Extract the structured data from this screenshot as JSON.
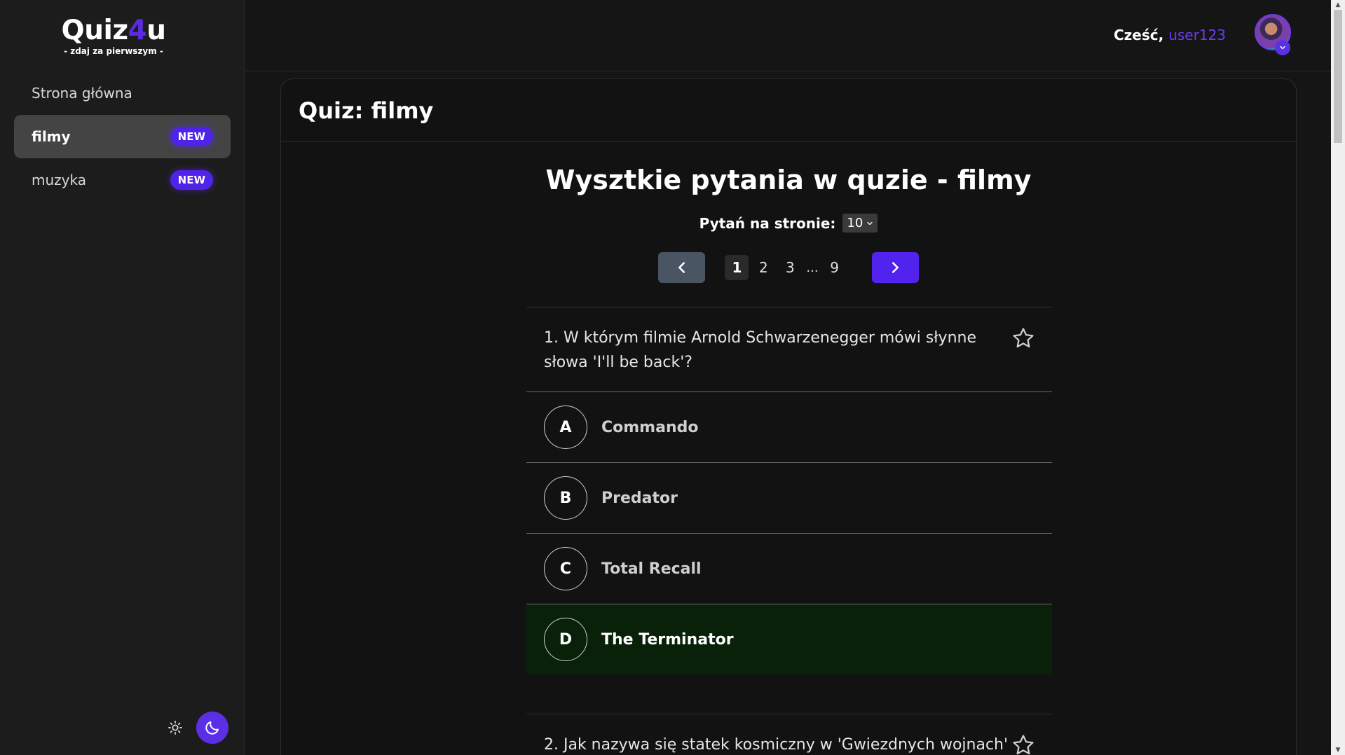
{
  "logo": {
    "title_main": "Quiz",
    "title_accent": "4",
    "title_end": "u",
    "subtitle": "- zdaj za pierwszym -"
  },
  "sidebar": {
    "items": [
      {
        "label": "Strona główna",
        "badge": ""
      },
      {
        "label": "filmy",
        "badge": "NEW"
      },
      {
        "label": "muzyka",
        "badge": "NEW"
      }
    ]
  },
  "header": {
    "greeting": "Cześć,",
    "username": "user123"
  },
  "card": {
    "title": "Quiz: filmy"
  },
  "section": {
    "title": "Wysztkie pytania w quzie - filmy"
  },
  "per_page": {
    "label": "Pytań na stronie:",
    "value": "10"
  },
  "pagination": {
    "pages": [
      "1",
      "2",
      "3"
    ],
    "dots": "...",
    "last": "9",
    "current": "1"
  },
  "questions": [
    {
      "text": "1. W którym filmie Arnold Schwarzenegger mówi słynne słowa 'I'll be back'?",
      "answers": [
        {
          "letter": "A",
          "text": "Commando"
        },
        {
          "letter": "B",
          "text": "Predator"
        },
        {
          "letter": "C",
          "text": "Total Recall"
        },
        {
          "letter": "D",
          "text": "The Terminator"
        }
      ],
      "correct": "D"
    },
    {
      "text": "2. Jak nazywa się statek kosmiczny w 'Gwiezdnych wojnach'"
    }
  ],
  "colors": {
    "accent": "#5223ee",
    "correct_bg": "#092109",
    "background": "#151515",
    "sidebar_bg": "#1c1c1c"
  },
  "icons": {
    "theme_light": "sun-icon",
    "theme_dark": "moon-icon",
    "favorite": "star-icon",
    "prev": "chevron-left-icon",
    "next": "chevron-right-icon"
  }
}
